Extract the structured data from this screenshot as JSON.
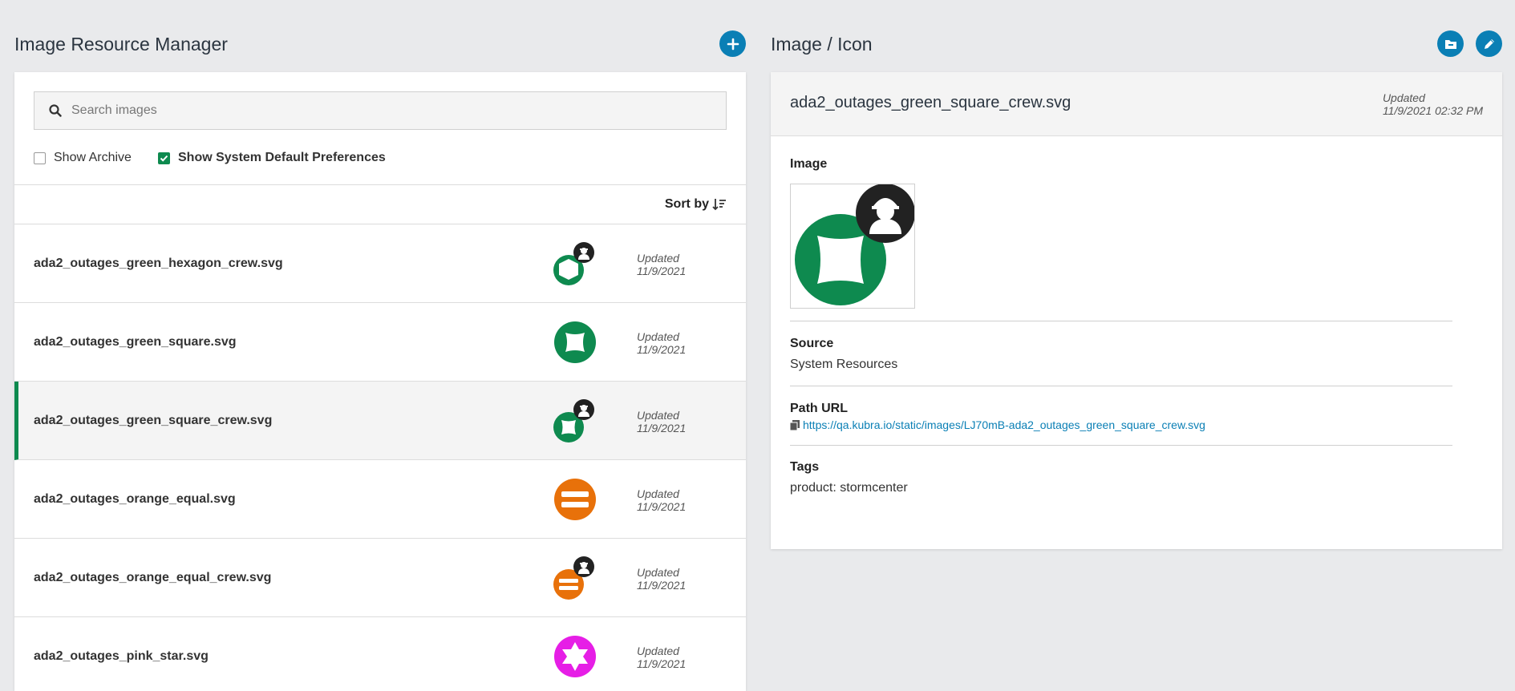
{
  "left_panel": {
    "title": "Image Resource Manager",
    "search": {
      "placeholder": "Search images",
      "value": ""
    },
    "filters": {
      "show_archive": {
        "label": "Show Archive",
        "checked": false
      },
      "show_system_defaults": {
        "label": "Show System Default Preferences",
        "checked": true
      }
    },
    "sort_label": "Sort by",
    "rows": [
      {
        "name": "ada2_outages_green_hexagon_crew.svg",
        "updated_label": "Updated",
        "updated_date": "11/9/2021",
        "icon": "green-hexagon-crew-icon",
        "color": "#0e8a4f"
      },
      {
        "name": "ada2_outages_green_square.svg",
        "updated_label": "Updated",
        "updated_date": "11/9/2021",
        "icon": "green-square-icon",
        "color": "#0e8a4f"
      },
      {
        "name": "ada2_outages_green_square_crew.svg",
        "updated_label": "Updated",
        "updated_date": "11/9/2021",
        "icon": "green-square-crew-icon",
        "color": "#0e8a4f",
        "selected": true
      },
      {
        "name": "ada2_outages_orange_equal.svg",
        "updated_label": "Updated",
        "updated_date": "11/9/2021",
        "icon": "orange-equal-icon",
        "color": "#e8710a"
      },
      {
        "name": "ada2_outages_orange_equal_crew.svg",
        "updated_label": "Updated",
        "updated_date": "11/9/2021",
        "icon": "orange-equal-crew-icon",
        "color": "#e8710a"
      },
      {
        "name": "ada2_outages_pink_star.svg",
        "updated_label": "Updated",
        "updated_date": "11/9/2021",
        "icon": "pink-star-icon",
        "color": "#e61ee6"
      }
    ]
  },
  "right_panel": {
    "title": "Image / Icon",
    "detail": {
      "name": "ada2_outages_green_square_crew.svg",
      "updated_label": "Updated",
      "updated_date": "11/9/2021 02:32 PM",
      "image_label": "Image",
      "source_label": "Source",
      "source_value": "System Resources",
      "path_label": "Path URL",
      "path_value": "https://qa.kubra.io/static/images/LJ70mB-ada2_outages_green_square_crew.svg",
      "tags_label": "Tags",
      "tags_value": "product: stormcenter"
    }
  },
  "colors": {
    "accent_blue": "#0a7fb5",
    "green": "#0e8a4f",
    "orange": "#e8710a",
    "pink": "#e61ee6",
    "crew_badge": "#222222"
  }
}
